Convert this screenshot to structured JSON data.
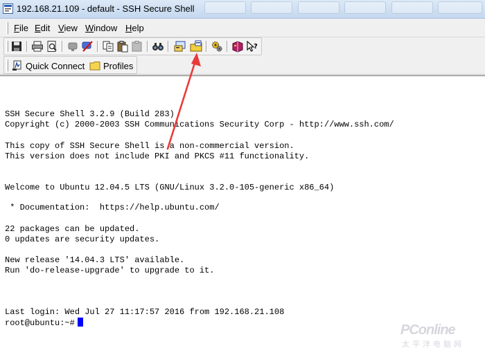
{
  "window": {
    "title": "192.168.21.109 - default - SSH Secure Shell"
  },
  "menu": {
    "items": [
      {
        "label_rest": "ile",
        "mnemonic": "F"
      },
      {
        "label_rest": "dit",
        "mnemonic": "E"
      },
      {
        "label_rest": "iew",
        "mnemonic": "V"
      },
      {
        "label_rest": "indow",
        "mnemonic": "W"
      },
      {
        "label_rest": "elp",
        "mnemonic": "H"
      }
    ]
  },
  "toolbar": {
    "icons": [
      "save-icon",
      "print-icon",
      "print-preview-icon",
      "disconnect-icon",
      "connect-icon",
      "copy-icon",
      "paste-icon",
      "paste-disabled-icon",
      "find-icon",
      "new-terminal-icon",
      "new-file-transfer-icon",
      "settings-icon",
      "help-book-icon",
      "context-help-icon"
    ]
  },
  "quickbar": {
    "quick_connect": "Quick Connect",
    "profiles": "Profiles"
  },
  "terminal": {
    "lines": [
      "SSH Secure Shell 3.2.9 (Build 283)",
      "Copyright (c) 2000-2003 SSH Communications Security Corp - http://www.ssh.com/",
      "",
      "This copy of SSH Secure Shell is a non-commercial version.",
      "This version does not include PKI and PKCS #11 functionality.",
      "",
      "",
      "Welcome to Ubuntu 12.04.5 LTS (GNU/Linux 3.2.0-105-generic x86_64)",
      "",
      " * Documentation:  https://help.ubuntu.com/",
      "",
      "22 packages can be updated.",
      "0 updates are security updates.",
      "",
      "New release '14.04.3 LTS' available.",
      "Run 'do-release-upgrade' to upgrade to it.",
      "",
      "",
      "",
      "Last login: Wed Jul 27 11:17:57 2016 from 192.168.21.108"
    ],
    "prompt": "root@ubuntu:~#"
  },
  "watermark": {
    "brand": "PConline",
    "sub": "太平洋电脑网"
  },
  "colors": {
    "cursor": "#0000ff",
    "annotation_arrow": "#e83b3b",
    "chrome": "#f0f0f0"
  }
}
